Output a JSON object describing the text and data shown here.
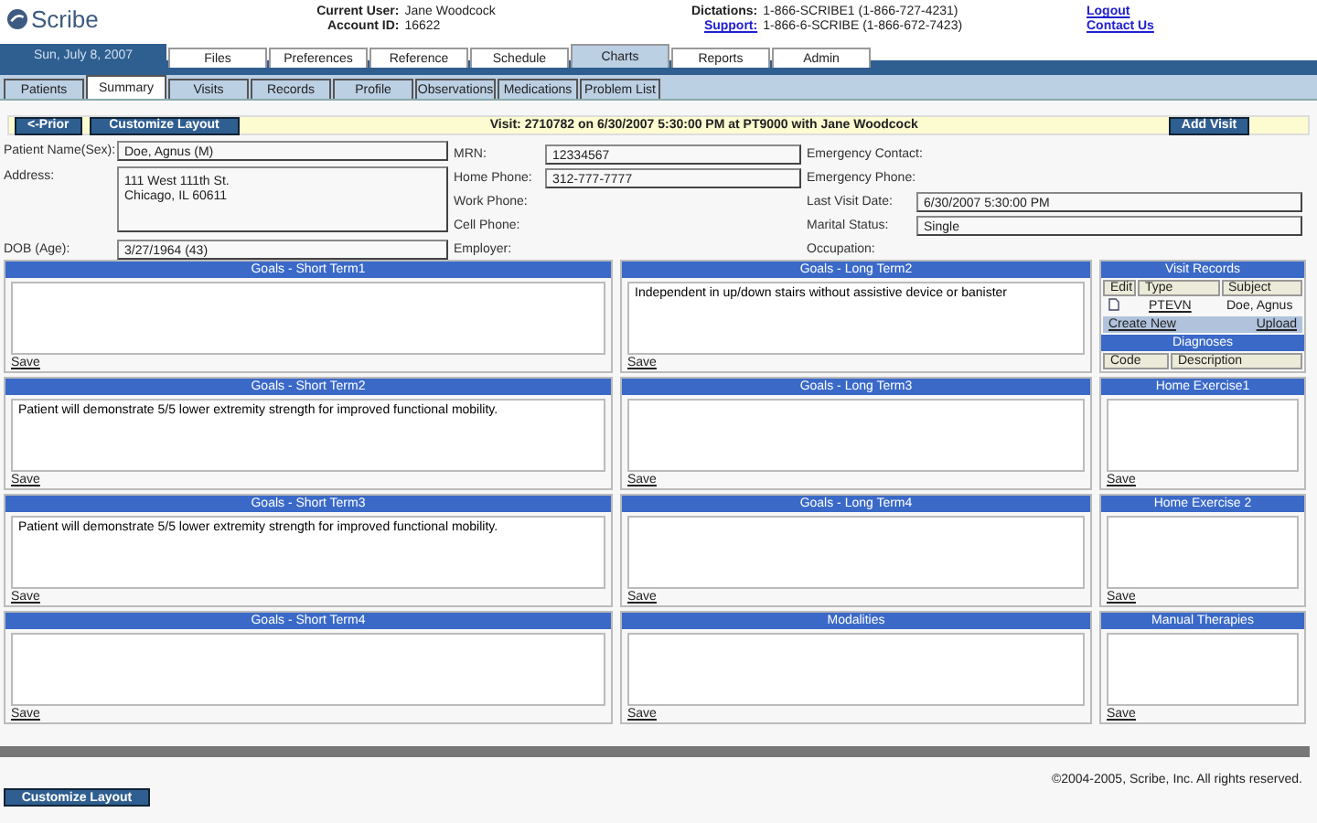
{
  "header": {
    "logo": "Scribe",
    "user_label": "Current User:",
    "user": "Jane Woodcock",
    "account_label": "Account ID:",
    "account": "16622",
    "dictations_label": "Dictations:",
    "dictations": "1-866-SCRIBE1 (1-866-727-4231)",
    "support_label": "Support:",
    "support": "1-866-6-SCRIBE (1-866-672-7423)",
    "links": [
      "Logout",
      "Contact Us"
    ]
  },
  "date": "Sun, July 8, 2007",
  "main_tabs": [
    {
      "label": "Files",
      "selected": false
    },
    {
      "label": "Preferences",
      "selected": false
    },
    {
      "label": "Reference",
      "selected": false
    },
    {
      "label": "Schedule",
      "selected": false
    },
    {
      "label": "Charts",
      "selected": true
    },
    {
      "label": "Reports",
      "selected": false
    },
    {
      "label": "Admin",
      "selected": false
    }
  ],
  "sub_tabs": [
    {
      "label": "Patients",
      "selected": false
    },
    {
      "label": "Summary",
      "selected": true
    },
    {
      "label": "Visits",
      "selected": false
    },
    {
      "label": "Records",
      "selected": false
    },
    {
      "label": "Profile",
      "selected": false
    },
    {
      "label": "Observations",
      "selected": false
    },
    {
      "label": "Medications",
      "selected": false
    },
    {
      "label": "Problem List",
      "selected": false
    }
  ],
  "visit_bar": {
    "prior": "<-Prior",
    "customize": "Customize Layout",
    "visit": "Visit: 2710782 on 6/30/2007 5:30:00 PM at PT9000 with Jane Woodcock",
    "add": "Add Visit"
  },
  "patient": [
    [
      {
        "label": "Patient Name(Sex):",
        "value": "Doe, Agnus (M)",
        "kind": "field"
      },
      {
        "label": "Address:",
        "value": "111 West 111th St.\nChicago, IL 60611",
        "kind": "tall"
      },
      {
        "label": "DOB (Age):",
        "value": "3/27/1964 (43)",
        "kind": "field"
      }
    ],
    [
      {
        "label": "MRN:",
        "value": "12334567",
        "kind": "field"
      },
      {
        "label": "Home Phone:",
        "value": "312-777-7777",
        "kind": "field"
      },
      {
        "label": "Work Phone:",
        "kind": "plain"
      },
      {
        "label": "Cell Phone:",
        "kind": "plain"
      },
      {
        "label": "Employer:",
        "kind": "plain"
      }
    ],
    [
      {
        "label": "Emergency Contact:",
        "kind": "plain"
      },
      {
        "label": "Emergency Phone:",
        "kind": "plain"
      },
      {
        "label": "Last Visit Date:",
        "value": "6/30/2007 5:30:00 PM",
        "kind": "field"
      },
      {
        "label": "Marital Status:",
        "value": "Single",
        "kind": "field"
      },
      {
        "label": "Occupation:",
        "kind": "plain"
      }
    ]
  ],
  "columns": [
    [
      {
        "title": "Goals - Short Term1",
        "save": "Save"
      },
      {
        "title": "Goals - Short Term2",
        "text": "Patient will demonstrate 5/5 lower extremity strength for improved functional mobility.",
        "save": "Save"
      },
      {
        "title": "Goals - Short Term3",
        "text": "Patient will demonstrate 5/5 lower extremity strength for improved functional mobility.",
        "save": "Save"
      },
      {
        "title": "Goals - Short Term4",
        "save": "Save"
      }
    ],
    [
      {
        "title": "Goals - Long Term2",
        "text": "Independent in up/down stairs without assistive device or banister",
        "save": "Save"
      },
      {
        "title": "Goals - Long Term3",
        "save": "Save"
      },
      {
        "title": "Goals - Long Term4",
        "save": "Save"
      },
      {
        "title": "Modalities",
        "save": "Save"
      }
    ]
  ],
  "visit_records": {
    "title": "Visit Records",
    "columns": [
      "Edit",
      "Type",
      "Subject"
    ],
    "rows": [
      {
        "type": "PTEVN",
        "subject": "Doe, Agnus"
      }
    ],
    "create": "Create New",
    "upload": "Upload"
  },
  "diagnoses": {
    "title": "Diagnoses",
    "columns": [
      "Code",
      "Description"
    ]
  },
  "side_panels": [
    {
      "title": "Home Exercise1",
      "save": "Save"
    },
    {
      "title": "Home Exercise 2",
      "save": "Save"
    },
    {
      "title": "Manual Therapies",
      "save": "Save"
    }
  ],
  "copyright": "©2004-2005, Scribe, Inc. All rights reserved.",
  "footer_button": "Customize Layout"
}
